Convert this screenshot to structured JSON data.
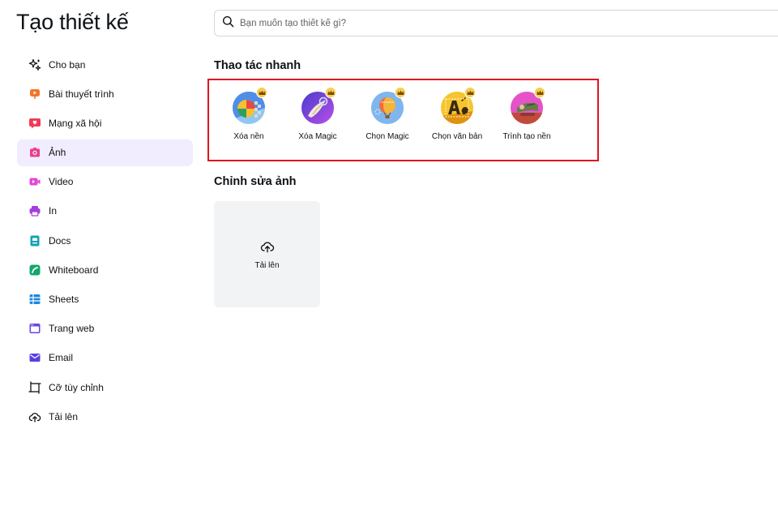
{
  "page": {
    "title": "Tạo thiết kế"
  },
  "search": {
    "placeholder": "Bạn muốn tạo thiết kế gì?"
  },
  "sidebar": {
    "items": [
      {
        "label": "Cho bạn",
        "icon": "sparkle-icon",
        "active": false
      },
      {
        "label": "Bài thuyết trình",
        "icon": "presentation-icon",
        "color": "#f2752b",
        "active": false
      },
      {
        "label": "Mạng xã hội",
        "icon": "heart-chat-icon",
        "color": "#f23a57",
        "active": false
      },
      {
        "label": "Ảnh",
        "icon": "camera-icon",
        "color": "#e8408f",
        "active": true
      },
      {
        "label": "Video",
        "icon": "video-camera-icon",
        "color": "#e448d6",
        "active": false
      },
      {
        "label": "In",
        "icon": "printer-icon",
        "color": "#a23fe0",
        "active": false
      },
      {
        "label": "Docs",
        "icon": "document-icon",
        "color": "#13a3b5",
        "active": false
      },
      {
        "label": "Whiteboard",
        "icon": "whiteboard-icon",
        "color": "#13a86b",
        "active": false
      },
      {
        "label": "Sheets",
        "icon": "sheet-grid-icon",
        "color": "#1d86e0",
        "active": false
      },
      {
        "label": "Trang web",
        "icon": "browser-icon",
        "color": "#6b43e3",
        "active": false
      },
      {
        "label": "Email",
        "icon": "envelope-icon",
        "color": "#5b3fe0",
        "active": false
      },
      {
        "label": "Cỡ tùy chỉnh",
        "icon": "custom-size-icon",
        "active": false
      },
      {
        "label": "Tải lên",
        "icon": "cloud-upload-icon",
        "active": false
      }
    ]
  },
  "quick_actions": {
    "heading": "Thao tác nhanh",
    "items": [
      {
        "label": "Xóa nền",
        "icon": "background-remover-icon",
        "premium": true
      },
      {
        "label": "Xóa Magic",
        "icon": "magic-eraser-icon",
        "premium": true
      },
      {
        "label": "Chọn Magic",
        "icon": "magic-grab-icon",
        "premium": true
      },
      {
        "label": "Chọn văn bản",
        "icon": "grab-text-icon",
        "premium": true
      },
      {
        "label": "Trình tạo nền",
        "icon": "background-generator-icon",
        "premium": true
      }
    ]
  },
  "edit_photo": {
    "heading": "Chỉnh sửa ảnh",
    "upload_label": "Tải lên"
  },
  "colors": {
    "accent": "#8b3dff",
    "active_bg": "#f1ecfe",
    "highlight_border": "#e0141e",
    "premium_crown": "#f6ce50"
  }
}
